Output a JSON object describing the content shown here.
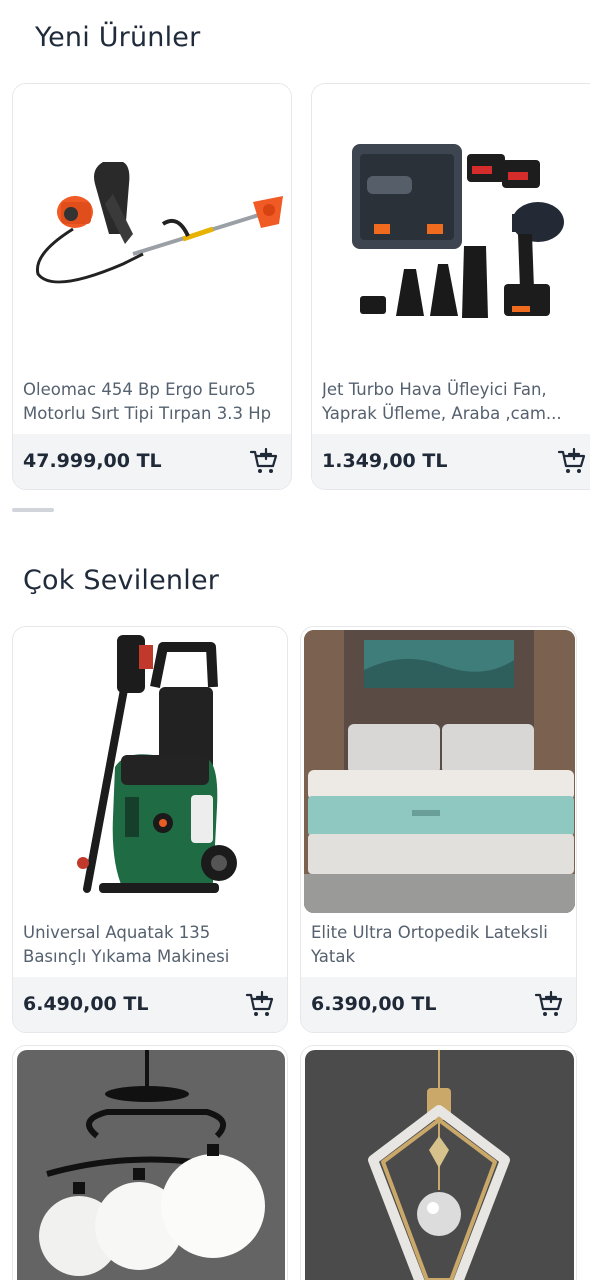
{
  "sections": {
    "new_products": {
      "title": "Yeni Ürünler",
      "products": [
        {
          "name": "Oleomac 454 Bp Ergo Euro5 Motorlu Sırt Tipi Tırpan 3.3 Hp",
          "price": "47.999,00 TL",
          "image": "brush-cutter-image"
        },
        {
          "name": "Jet Turbo Hava Üfleyici Fan, Yaprak Üfleme, Araba ,cam...",
          "price": "1.349,00 TL",
          "image": "air-blower-kit-image"
        }
      ]
    },
    "favorites": {
      "title": "Çok Sevilenler",
      "products": [
        {
          "name": "Universal Aquatak 135 Basınçlı Yıkama Makinesi",
          "price": "6.490,00 TL",
          "image": "pressure-washer-image"
        },
        {
          "name": "Elite Ultra Ortopedik Lateksli Yatak",
          "price": "6.390,00 TL",
          "image": "mattress-image"
        },
        {
          "name": "",
          "price": "",
          "image": "chandelier-image"
        },
        {
          "name": "",
          "price": "",
          "image": "pendant-lamp-image"
        }
      ]
    }
  },
  "icons": {
    "cart": "add-to-cart-icon"
  },
  "colors": {
    "price_bar": "#f3f4f6",
    "text_dark": "#1f2937",
    "text_muted": "#55616f"
  }
}
